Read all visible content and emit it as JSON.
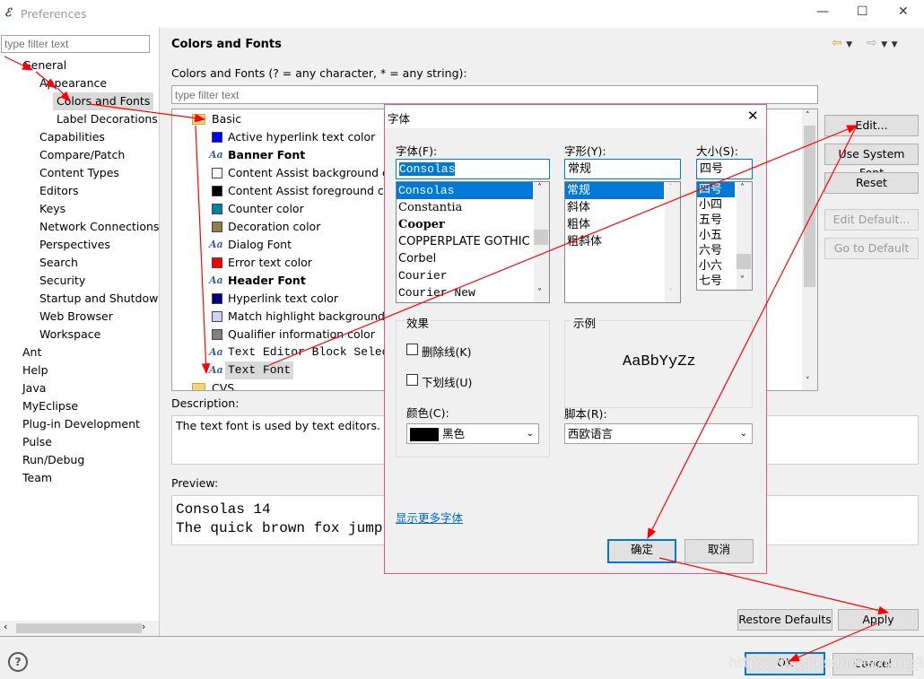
{
  "window": {
    "title": "Preferences",
    "controls": [
      "—",
      "☐",
      "✕"
    ]
  },
  "sidebar": {
    "filter_placeholder": "type filter text",
    "items": [
      {
        "label": "General",
        "level": 0
      },
      {
        "label": "Appearance",
        "level": 1
      },
      {
        "label": "Colors and Fonts",
        "level": 2,
        "selected": true
      },
      {
        "label": "Label Decorations",
        "level": 2
      },
      {
        "label": "Capabilities",
        "level": 1
      },
      {
        "label": "Compare/Patch",
        "level": 1
      },
      {
        "label": "Content Types",
        "level": 1
      },
      {
        "label": "Editors",
        "level": 1
      },
      {
        "label": "Keys",
        "level": 1
      },
      {
        "label": "Network Connections",
        "level": 1
      },
      {
        "label": "Perspectives",
        "level": 1
      },
      {
        "label": "Search",
        "level": 1
      },
      {
        "label": "Security",
        "level": 1
      },
      {
        "label": "Startup and Shutdow",
        "level": 1
      },
      {
        "label": "Web Browser",
        "level": 1
      },
      {
        "label": "Workspace",
        "level": 1
      },
      {
        "label": "Ant",
        "level": 0
      },
      {
        "label": "Help",
        "level": 0
      },
      {
        "label": "Java",
        "level": 0
      },
      {
        "label": "MyEclipse",
        "level": 0
      },
      {
        "label": "Plug-in Development",
        "level": 0
      },
      {
        "label": "Pulse",
        "level": 0
      },
      {
        "label": "Run/Debug",
        "level": 0
      },
      {
        "label": "Team",
        "level": 0
      }
    ]
  },
  "main": {
    "title": "Colors and Fonts",
    "filter_label": "Colors and Fonts (? = any character, * = any string):",
    "filter_placeholder": "type filter text",
    "tree": [
      {
        "label": "Basic",
        "type": "folder"
      },
      {
        "label": "Active hyperlink text color",
        "type": "color",
        "color": "#0000ff"
      },
      {
        "label": "Banner Font",
        "type": "font",
        "bold": true
      },
      {
        "label": "Content Assist background co",
        "type": "color",
        "color": "#ffffff"
      },
      {
        "label": "Content Assist foreground col",
        "type": "color",
        "color": "#000000"
      },
      {
        "label": "Counter color",
        "type": "color",
        "color": "#0080a8"
      },
      {
        "label": "Decoration color",
        "type": "color",
        "color": "#957d47"
      },
      {
        "label": "Dialog Font",
        "type": "font"
      },
      {
        "label": "Error text color",
        "type": "color",
        "color": "#ff0000"
      },
      {
        "label": "Header Font",
        "type": "font",
        "bold": true
      },
      {
        "label": "Hyperlink text color",
        "type": "color",
        "color": "#000080"
      },
      {
        "label": "Match highlight background c",
        "type": "color",
        "color": "#d0d0f5"
      },
      {
        "label": "Qualifier information color",
        "type": "color",
        "color": "#808080"
      },
      {
        "label": "Text Editor Block Selecti",
        "type": "font",
        "mono": true
      },
      {
        "label": "Text Font",
        "type": "font",
        "mono": true,
        "selected": true
      },
      {
        "label": "CVS",
        "type": "folder"
      }
    ],
    "buttons": {
      "edit": "Edit...",
      "use_system": "Use System Font",
      "reset": "Reset",
      "edit_default": "Edit Default...",
      "go_default": "Go to Default"
    },
    "description_label": "Description:",
    "description": "The text font is used by text editors.",
    "preview_label": "Preview:",
    "preview_lines": [
      "Consolas 14",
      "The quick brown fox jump"
    ]
  },
  "footer": {
    "restore": "Restore Defaults",
    "apply": "Apply",
    "ok": "OK",
    "cancel": "Cancel",
    "watermark": "https://blog.csdn.net/Yangjl29"
  },
  "font_dialog": {
    "title": "字体",
    "font_label": "字体(F):",
    "font_value": "Consolas",
    "fonts": [
      "Consolas",
      "Constantia",
      "Cooper",
      "COPPERPLATE GOTHIC",
      "Corbel",
      "Courier",
      "Courier New"
    ],
    "style_label": "字形(Y):",
    "style_value": "常规",
    "styles": [
      "常规",
      "斜体",
      "粗体",
      "粗斜体"
    ],
    "size_label": "大小(S):",
    "size_value": "四号",
    "sizes": [
      "四号",
      "小四",
      "五号",
      "小五",
      "六号",
      "小六",
      "七号"
    ],
    "effects_label": "效果",
    "strike": "删除线(K)",
    "underline": "下划线(U)",
    "color_label": "颜色(C):",
    "color_value": "黑色",
    "sample_label": "示例",
    "sample_text": "AaBbYyZz",
    "script_label": "脚本(R):",
    "script_value": "西欧语言",
    "more_fonts": "显示更多字体",
    "ok": "确定",
    "cancel": "取消"
  }
}
